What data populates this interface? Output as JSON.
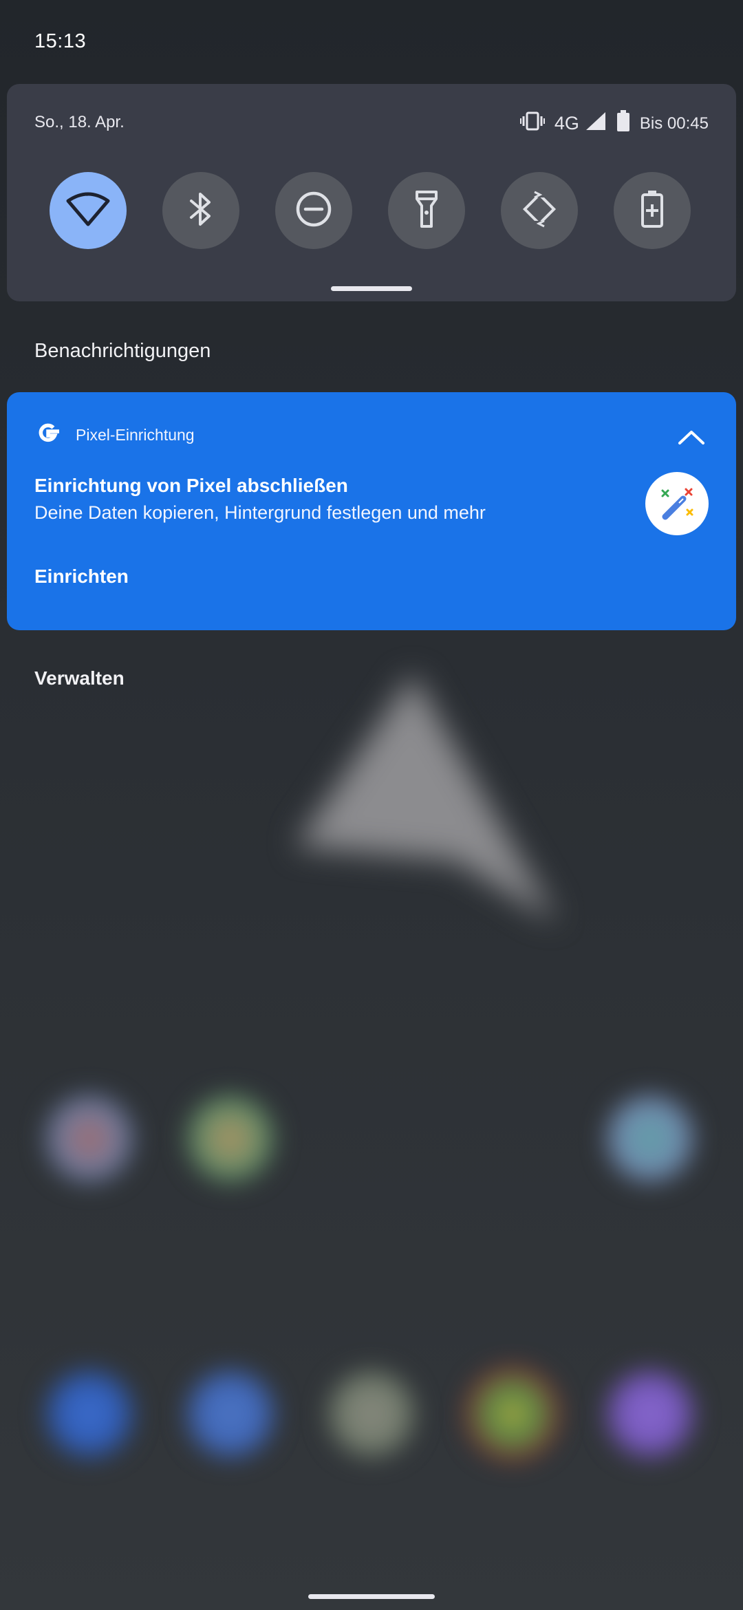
{
  "status_bar": {
    "time": "15:13"
  },
  "quick_settings": {
    "date": "So., 18. Apr.",
    "network_type": "4G",
    "battery_text": "Bis 00:45",
    "tiles": [
      {
        "icon": "wifi-icon",
        "active": true
      },
      {
        "icon": "bluetooth-icon",
        "active": false
      },
      {
        "icon": "do-not-disturb-icon",
        "active": false
      },
      {
        "icon": "flashlight-icon",
        "active": false
      },
      {
        "icon": "auto-rotate-icon",
        "active": false
      },
      {
        "icon": "battery-saver-icon",
        "active": false
      }
    ]
  },
  "notifications": {
    "section_title": "Benachrichtigungen",
    "items": [
      {
        "app_name": "Pixel-Einrichtung",
        "app_icon": "google-g-icon",
        "title": "Einrichtung von Pixel abschließen",
        "text": "Deine Daten kopieren, Hintergrund festlegen und mehr",
        "large_icon": "magic-wand-icon",
        "action": "Einrichten",
        "background_color": "#1a73e8"
      }
    ],
    "manage_label": "Verwalten"
  },
  "colors": {
    "tile_active": "#8ab4f8",
    "tile_inactive": "#55585f",
    "panel": "#3a3d48"
  }
}
